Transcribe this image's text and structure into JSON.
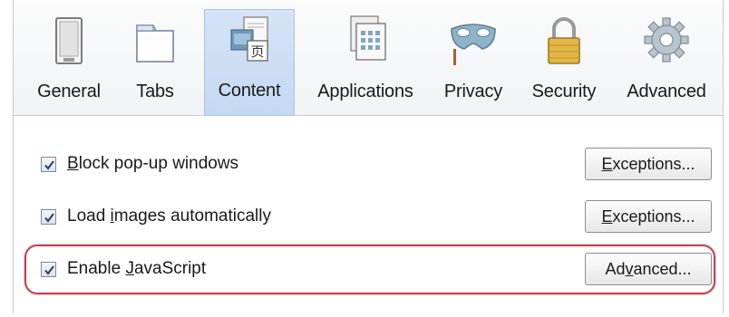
{
  "toolbar": {
    "items": [
      {
        "label": "General",
        "icon": "general-icon"
      },
      {
        "label": "Tabs",
        "icon": "tabs-icon"
      },
      {
        "label": "Content",
        "icon": "content-icon",
        "selected": true
      },
      {
        "label": "Applications",
        "icon": "applications-icon"
      },
      {
        "label": "Privacy",
        "icon": "privacy-mask-icon"
      },
      {
        "label": "Security",
        "icon": "padlock-icon"
      },
      {
        "label": "Advanced",
        "icon": "gear-icon"
      }
    ]
  },
  "options": [
    {
      "pre": "",
      "u": "B",
      "post": "lock pop-up windows",
      "checked": true,
      "button": {
        "pre": "",
        "u": "E",
        "post": "xceptions..."
      }
    },
    {
      "pre": "Load ",
      "u": "i",
      "post": "mages automatically",
      "checked": true,
      "button": {
        "pre": "",
        "u": "E",
        "post": "xceptions..."
      }
    },
    {
      "pre": "Enable ",
      "u": "J",
      "post": "avaScript",
      "checked": true,
      "button": {
        "pre": "Ad",
        "u": "v",
        "post": "anced..."
      }
    }
  ],
  "colors": {
    "highlight": "#c6414a",
    "selected_tab": "#c6d9f3"
  }
}
